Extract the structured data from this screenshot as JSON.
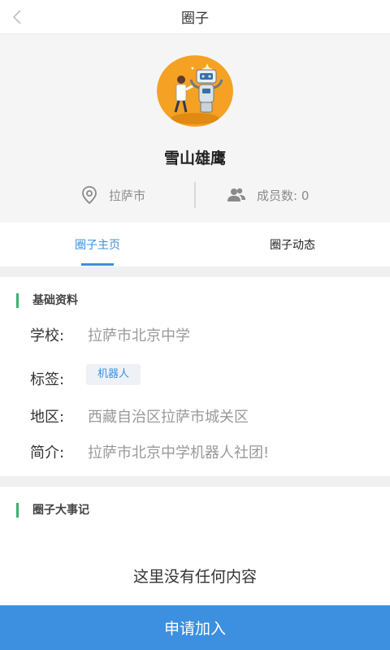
{
  "header": {
    "title": "圈子",
    "back_icon": "chevron-left-icon"
  },
  "profile": {
    "avatar_icon": "robot-avatar-icon",
    "name": "雪山雄鹰",
    "location": "拉萨市",
    "location_icon": "location-pin-icon",
    "members_text": "成员数: 0",
    "members_icon": "users-icon"
  },
  "tabs": [
    {
      "label": "圈子主页",
      "active": true
    },
    {
      "label": "圈子动态",
      "active": false
    }
  ],
  "basic_info": {
    "title": "基础资料",
    "school_label": "学校:",
    "school_value": "拉萨市北京中学",
    "tags_label": "标签:",
    "tag": "机器人",
    "region_label": "地区:",
    "region_value": "西藏自治区拉萨市城关区",
    "intro_label": "简介:",
    "intro_value": "拉萨市北京中学机器人社团!"
  },
  "events": {
    "title": "圈子大事记",
    "empty_text": "这里没有任何内容"
  },
  "join_button": "申请加入",
  "colors": {
    "accent": "#3d8fdf",
    "section_bar": "#3bb26f",
    "avatar_bg": "#f5a123",
    "background": "#f5f5f5"
  }
}
